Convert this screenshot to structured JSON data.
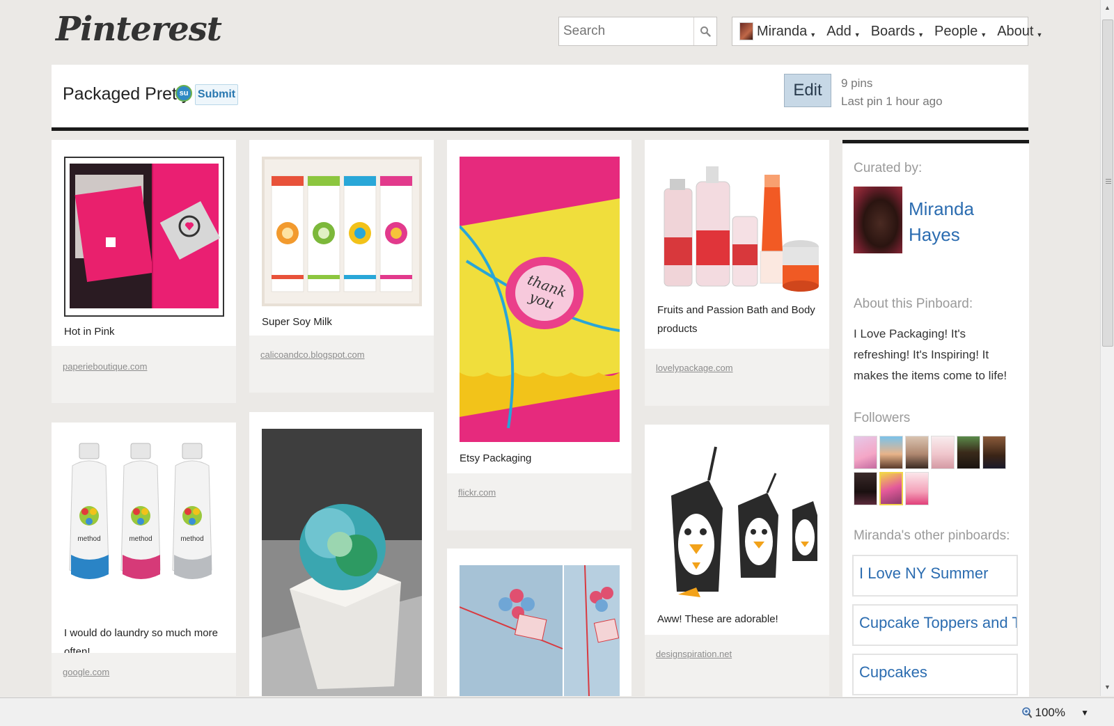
{
  "header": {
    "logo": "Pinterest",
    "search": {
      "placeholder": "Search"
    },
    "nav": {
      "user": "Miranda",
      "add": "Add",
      "boards": "Boards",
      "people": "People",
      "about": "About"
    }
  },
  "board": {
    "title": "Packaged Pretty",
    "submit_label": "Submit",
    "edit_label": "Edit",
    "pin_count": "9 pins",
    "last_pin": "Last pin 1 hour ago"
  },
  "pins": [
    {
      "caption": "Hot in Pink",
      "source": "paperieboutique.com"
    },
    {
      "caption": "Super Soy Milk",
      "source": "calicoandco.blogspot.com"
    },
    {
      "caption": "Etsy Packaging",
      "source": "flickr.com"
    },
    {
      "caption": "Fruits and Passion Bath and Body products",
      "source": "lovelypackage.com"
    },
    {
      "caption": "I would do laundry so much more often!",
      "source": "google.com"
    },
    {
      "caption": "",
      "source": ""
    },
    {
      "caption": "",
      "source": ""
    },
    {
      "caption": "Aww! These are adorable!",
      "source": "designspiration.net"
    }
  ],
  "sidebar": {
    "curated_by_label": "Curated by:",
    "curator_name": "Miranda Hayes",
    "about_label": "About this Pinboard:",
    "about_text": "I Love Packaging! It's refreshing! It's Inspiring! It makes the items come to life!",
    "followers_label": "Followers",
    "other_boards_label": "Miranda's other pinboards:",
    "other_boards": [
      "I Love NY Summer",
      "Cupcake Toppers and Tags",
      "Cupcakes"
    ]
  },
  "statusbar": {
    "zoom": "100%"
  },
  "colors": {
    "link": "#2b6cb0",
    "background": "#ebe9e6",
    "rule": "#1a1a1a"
  }
}
